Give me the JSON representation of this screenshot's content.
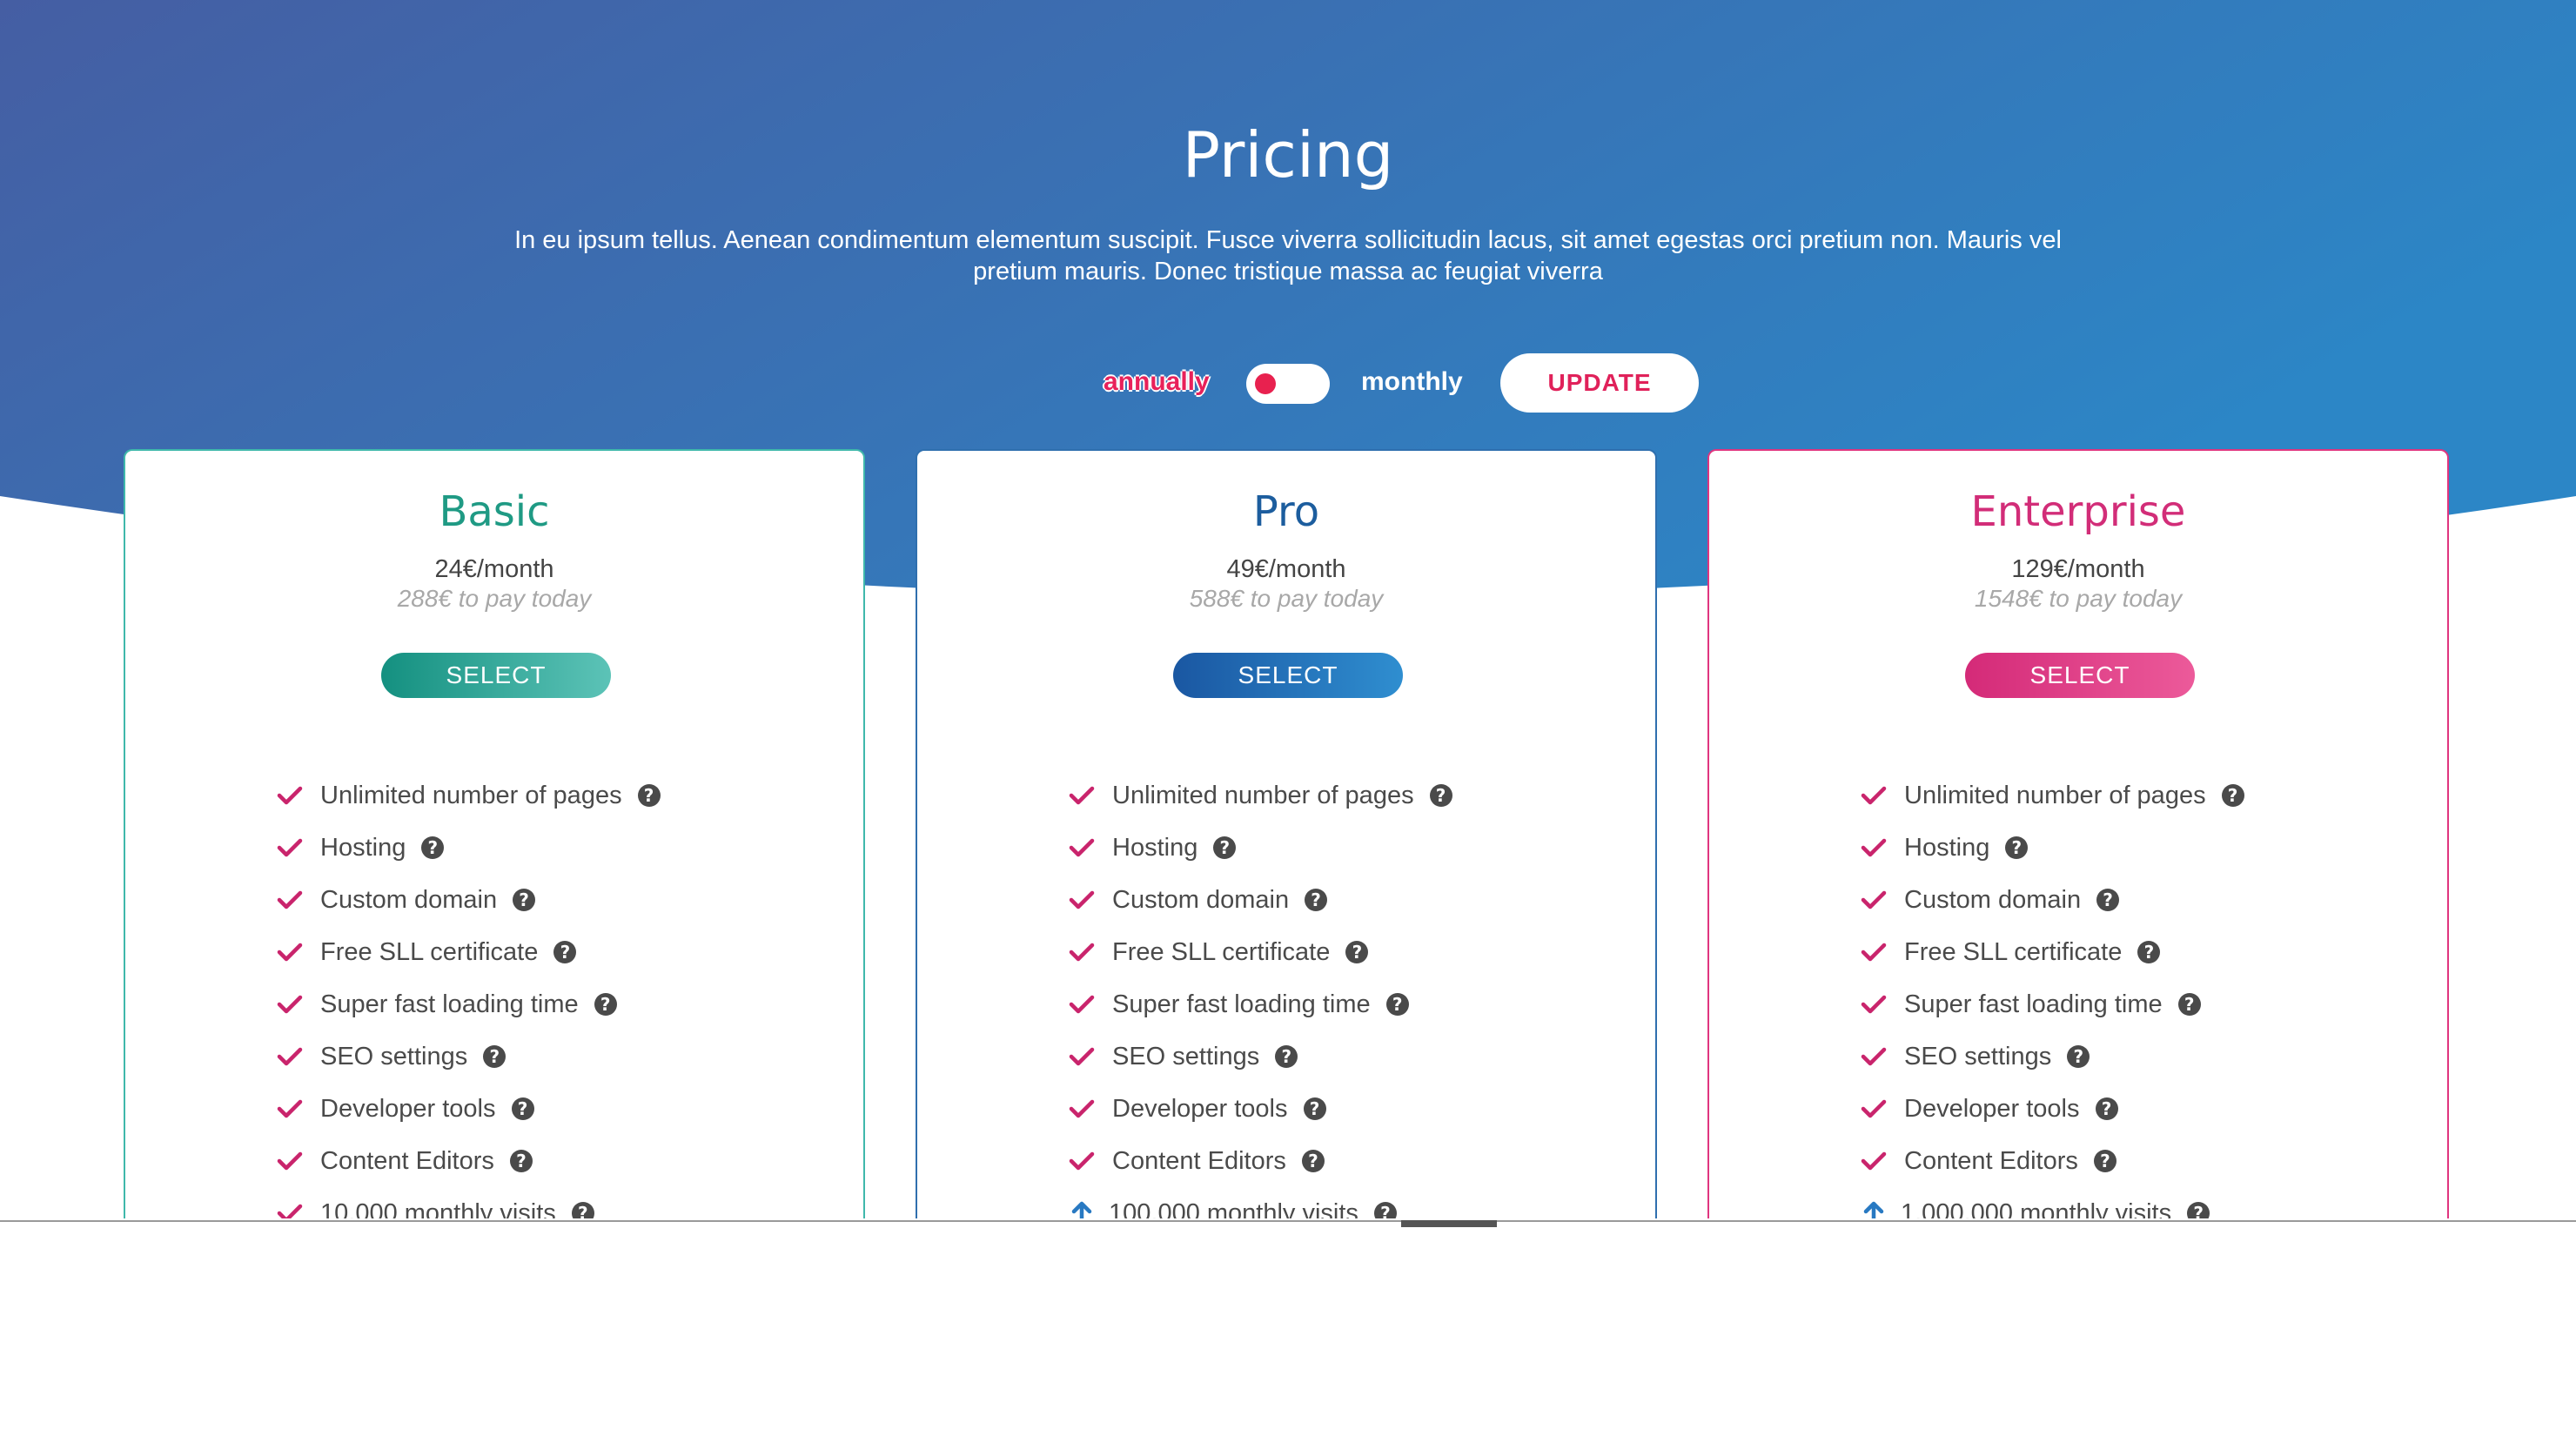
{
  "colors": {
    "hero_gradient_start": "#455ea3",
    "hero_gradient_end": "#2c86c6",
    "accent_pink": "#e0215a",
    "basic": "#1f9a84",
    "pro": "#1c5d9e",
    "enterprise": "#d22d78",
    "check": "#c9246c",
    "arrow": "#2879c2"
  },
  "header": {
    "title": "Pricing",
    "description": "In eu ipsum tellus. Aenean condimentum elementum suscipit. Fusce viverra sollicitudin lacus, sit amet egestas orci pretium non. Mauris vel pretium mauris. Donec tristique massa ac feugiat viverra"
  },
  "billing": {
    "annually_label": "annually",
    "monthly_label": "monthly",
    "toggle_state": "annually",
    "update_label": "UPDATE"
  },
  "plans": [
    {
      "name": "Basic",
      "price": "24€/month",
      "total": "288€ to pay today",
      "select_label": "SELECT",
      "features": [
        {
          "label": "Unlimited number of pages",
          "icon": "check-icon"
        },
        {
          "label": "Hosting",
          "icon": "check-icon"
        },
        {
          "label": "Custom domain",
          "icon": "check-icon"
        },
        {
          "label": "Free SLL certificate",
          "icon": "check-icon"
        },
        {
          "label": "Super fast loading time",
          "icon": "check-icon"
        },
        {
          "label": "SEO settings",
          "icon": "check-icon"
        },
        {
          "label": "Developer tools",
          "icon": "check-icon"
        },
        {
          "label": "Content Editors",
          "icon": "check-icon"
        },
        {
          "label": "10.000 monthly visits",
          "icon": "check-icon"
        }
      ]
    },
    {
      "name": "Pro",
      "price": "49€/month",
      "total": "588€ to pay today",
      "select_label": "SELECT",
      "features": [
        {
          "label": "Unlimited number of pages",
          "icon": "check-icon"
        },
        {
          "label": "Hosting",
          "icon": "check-icon"
        },
        {
          "label": "Custom domain",
          "icon": "check-icon"
        },
        {
          "label": "Free SLL certificate",
          "icon": "check-icon"
        },
        {
          "label": "Super fast loading time",
          "icon": "check-icon"
        },
        {
          "label": "SEO settings",
          "icon": "check-icon"
        },
        {
          "label": "Developer tools",
          "icon": "check-icon"
        },
        {
          "label": "Content Editors",
          "icon": "check-icon"
        },
        {
          "label": "100.000 monthly visits",
          "icon": "arrow-up-icon"
        }
      ]
    },
    {
      "name": "Enterprise",
      "price": "129€/month",
      "total": "1548€ to pay today",
      "select_label": "SELECT",
      "features": [
        {
          "label": "Unlimited number of pages",
          "icon": "check-icon"
        },
        {
          "label": "Hosting",
          "icon": "check-icon"
        },
        {
          "label": "Custom domain",
          "icon": "check-icon"
        },
        {
          "label": "Free SLL certificate",
          "icon": "check-icon"
        },
        {
          "label": "Super fast loading time",
          "icon": "check-icon"
        },
        {
          "label": "SEO settings",
          "icon": "check-icon"
        },
        {
          "label": "Developer tools",
          "icon": "check-icon"
        },
        {
          "label": "Content Editors",
          "icon": "check-icon"
        },
        {
          "label": "1.000.000 monthly visits",
          "icon": "arrow-up-icon"
        }
      ]
    }
  ]
}
